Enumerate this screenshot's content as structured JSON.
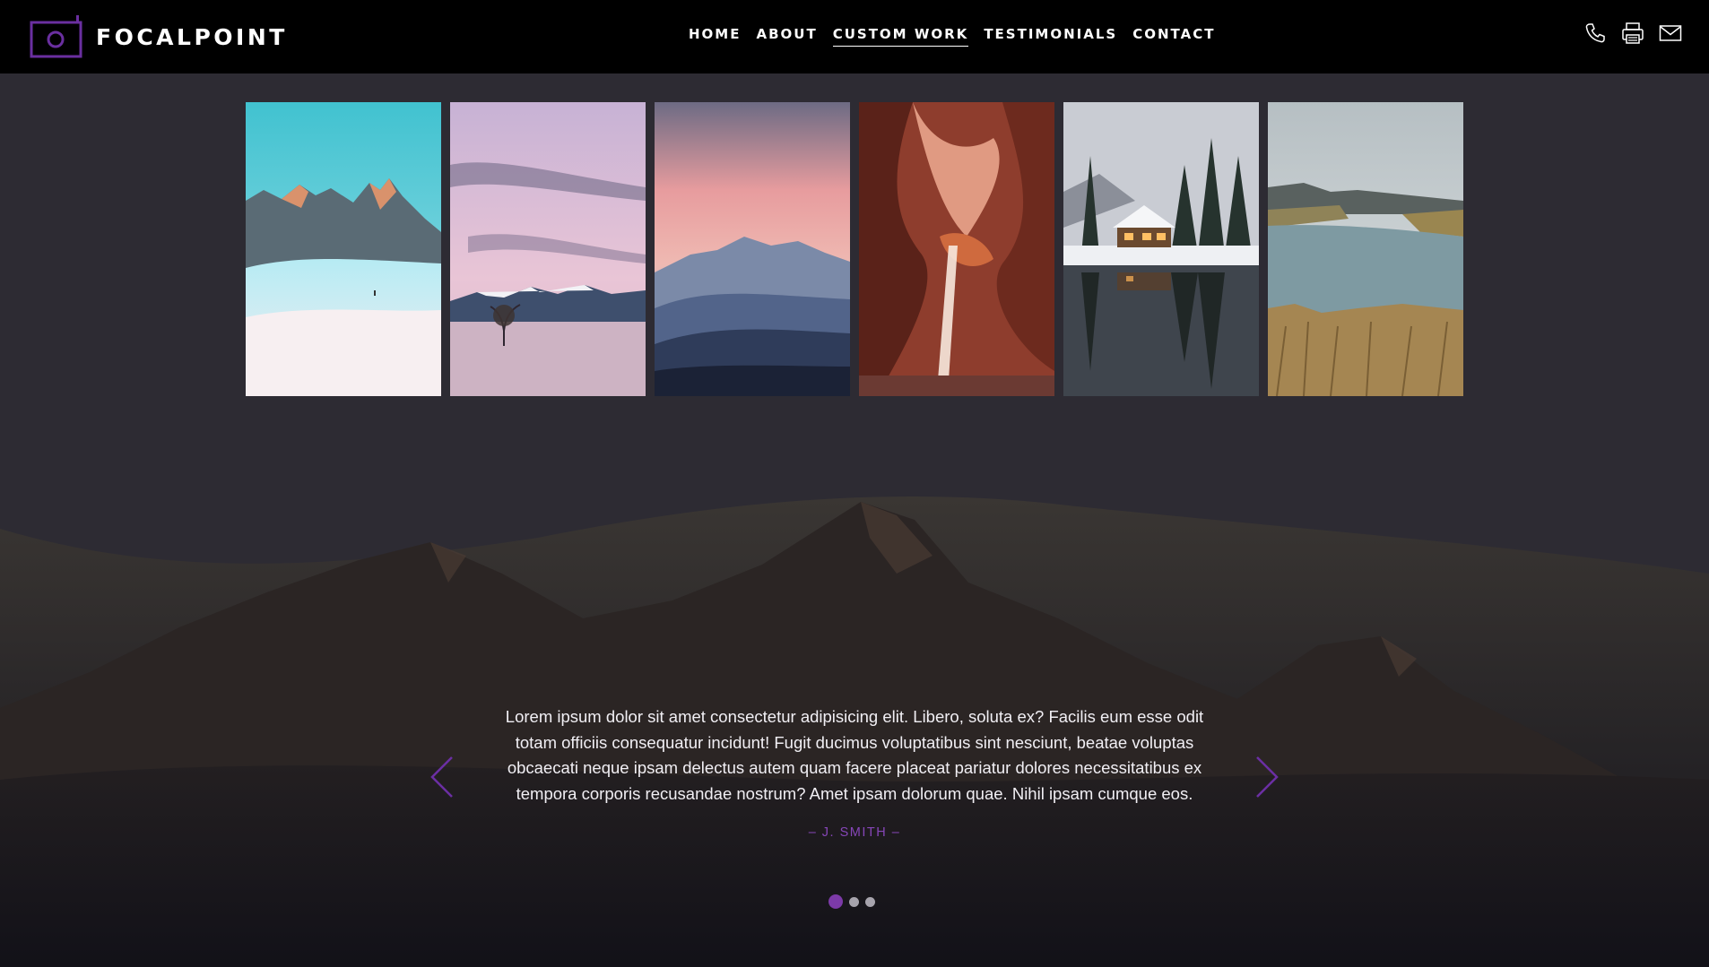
{
  "header": {
    "brand": "FOCALPOINT",
    "nav": [
      {
        "label": "HOME",
        "active": false
      },
      {
        "label": "ABOUT",
        "active": false
      },
      {
        "label": "CUSTOM WORK",
        "active": true
      },
      {
        "label": "TESTIMONIALS",
        "active": false
      },
      {
        "label": "CONTACT",
        "active": false
      }
    ],
    "icons": [
      "phone-icon",
      "fax-icon",
      "mail-icon"
    ]
  },
  "gallery": {
    "photos": [
      "snowy-mountain-peaks-photo",
      "lone-tree-lake-sunset-photo",
      "pink-sky-mountain-range-photo",
      "slot-canyon-light-beam-photo",
      "snowy-cabin-reflection-photo",
      "misty-river-marsh-photo"
    ]
  },
  "testimonial": {
    "quote": "Lorem ipsum dolor sit amet consectetur adipisicing elit. Libero, soluta ex? Facilis eum esse odit totam officiis consequatur incidunt! Fugit ducimus voluptatibus sint nesciunt, beatae voluptas obcaecati neque ipsam delectus autem quam facere placeat pariatur dolores necessitatibus ex tempora corporis recusandae nostrum? Amet ipsam dolorum quae. Nihil ipsam cumque eos.",
    "author": "– J. SMITH –",
    "slides": 3,
    "active_slide": 1
  },
  "colors": {
    "accent": "#7c3aa8",
    "header_bg": "#000000",
    "page_bg": "#2d2b33"
  }
}
